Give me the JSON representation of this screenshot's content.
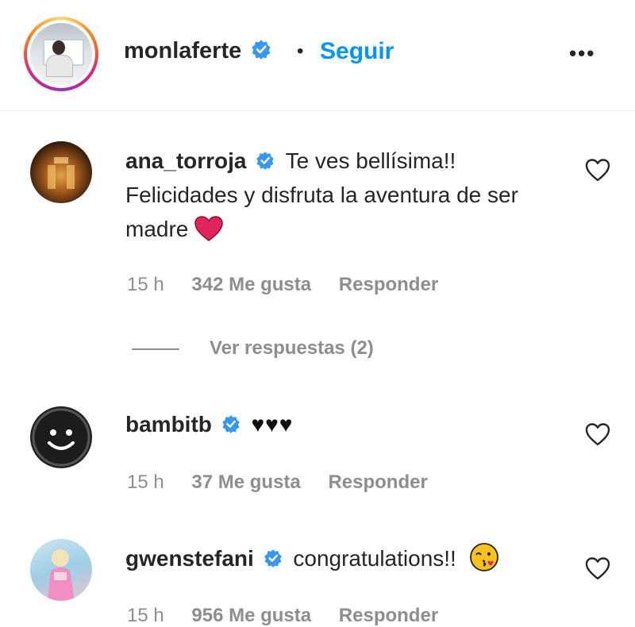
{
  "post_owner": {
    "username": "monlaferte",
    "separator": "•",
    "follow_label": "Seguir",
    "more_label": "•••"
  },
  "colors": {
    "accent": "#0095f6",
    "verified": "#3897f0",
    "muted": "#8e8e8e",
    "heart_emoji": "#e0245e"
  },
  "comments": [
    {
      "username": "ana_torroja",
      "text": "Te ves bellísima!! Felicidades y disfruta la aventura de ser madre",
      "emoji": "red-heart-emoji",
      "time": "15 h",
      "likes": "342 Me gusta",
      "reply_label": "Responder",
      "view_replies": "Ver respuestas (2)"
    },
    {
      "username": "bambitb",
      "text": "♥♥♥",
      "time": "15 h",
      "likes": "37 Me gusta",
      "reply_label": "Responder"
    },
    {
      "username": "gwenstefani",
      "text": "congratulations!!",
      "emoji": "winking-kiss-emoji",
      "time": "15 h",
      "likes": "956 Me gusta",
      "reply_label": "Responder"
    }
  ],
  "icons": [
    "verified-badge-icon",
    "heart-outline-icon",
    "more-options-icon"
  ]
}
